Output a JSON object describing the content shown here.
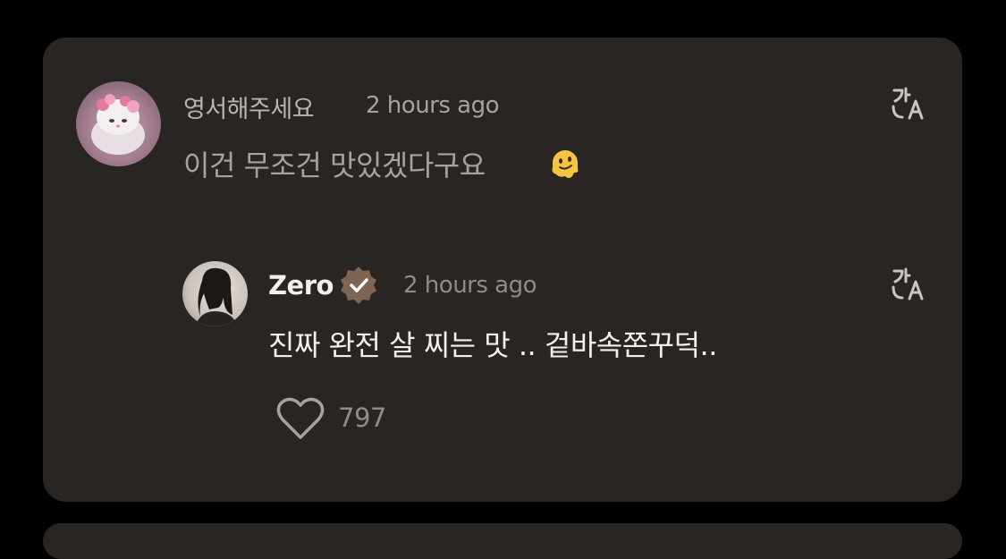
{
  "comment": {
    "username": "영서해주세요",
    "time": "2 hours ago",
    "text": "이건 무조건 맛있겠다구요",
    "emoji_icon": "melting-face-icon",
    "translate_icon": "translate-icon",
    "avatar_icon": "avatar-sheep-plush"
  },
  "reply": {
    "username": "Zero",
    "verified_icon": "verified-badge-icon",
    "time": "2 hours ago",
    "text": "진짜 완전 살 찌는 맛 .. 겉바속쫀꾸덕..",
    "likes": "797",
    "like_icon": "heart-outline-icon",
    "translate_icon": "translate-icon",
    "avatar_icon": "avatar-person-photo"
  },
  "colors": {
    "background": "#000000",
    "card": "#292522",
    "primary_text": "#f2f0ee",
    "secondary_text": "#a6a29e",
    "muted_text": "#8f8b87",
    "verified_badge": "#7d6554"
  }
}
